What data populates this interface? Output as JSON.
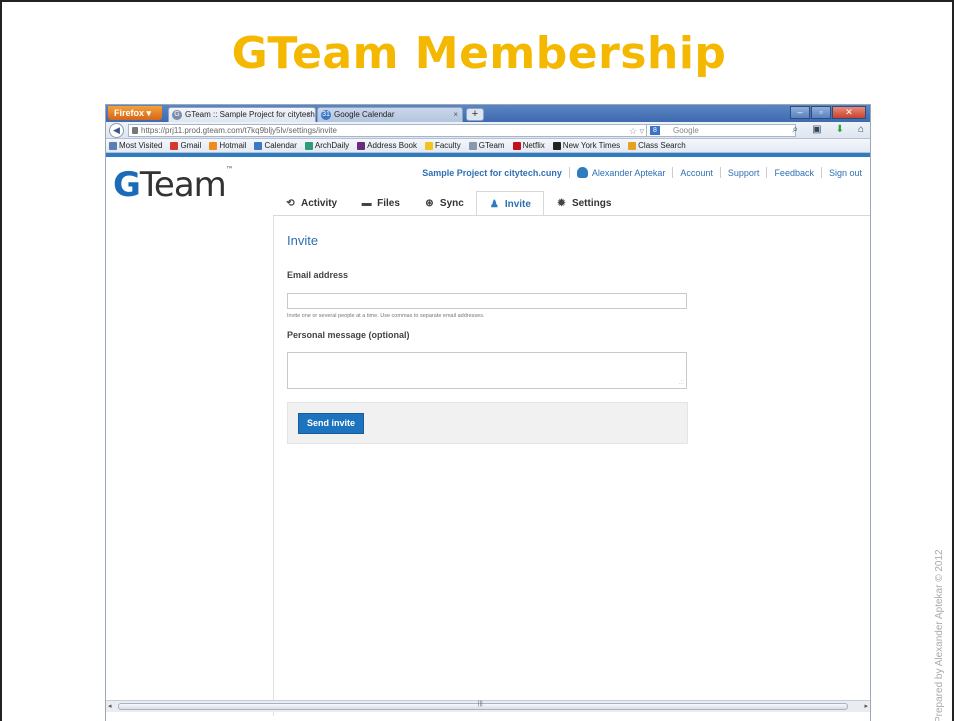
{
  "slide": {
    "title": "GTeam Membership",
    "credit": "Prepared by Alexander Aptekar © 2012"
  },
  "browser": {
    "firefox_label": "Firefox",
    "tabs": [
      {
        "label": "GTeam :: Sample Project for citytech...."
      },
      {
        "label": "Google Calendar"
      }
    ],
    "url": "https://prj11.prod.gteam.com/t7kq9bljy5lv/settings/invite",
    "url_host_bold": "gteam.com",
    "search_placeholder": "Google",
    "bookmarks": [
      {
        "label": "Most Visited",
        "color": "#5a7fb3"
      },
      {
        "label": "Gmail",
        "color": "#d23a2f"
      },
      {
        "label": "Hotmail",
        "color": "#f28b1f"
      },
      {
        "label": "Calendar",
        "color": "#3a77c9"
      },
      {
        "label": "ArchDaily",
        "color": "#2e9c7a"
      },
      {
        "label": "Address Book",
        "color": "#6a2b7e"
      },
      {
        "label": "Faculty",
        "color": "#f2c21f"
      },
      {
        "label": "GTeam",
        "color": "#8a98ad"
      },
      {
        "label": "Netflix",
        "color": "#c1121c"
      },
      {
        "label": "New York Times",
        "color": "#222222"
      },
      {
        "label": "Class Search",
        "color": "#e6a11f"
      }
    ]
  },
  "app": {
    "logo_g": "G",
    "logo_rest": "Team",
    "logo_tm": "™",
    "topnav": {
      "project": "Sample Project for citytech.cuny",
      "user": "Alexander Aptekar",
      "account": "Account",
      "support": "Support",
      "feedback": "Feedback",
      "signout": "Sign out"
    },
    "tabs": [
      {
        "label": "Activity",
        "icon": "history-icon"
      },
      {
        "label": "Files",
        "icon": "folder-icon"
      },
      {
        "label": "Sync",
        "icon": "sync-icon"
      },
      {
        "label": "Invite",
        "icon": "user-add-icon",
        "active": true
      },
      {
        "label": "Settings",
        "icon": "gear-icon"
      }
    ],
    "invite": {
      "heading": "Invite",
      "email_label": "Email address",
      "email_value": "",
      "hint": "Invite one or several people at a time. Use commas to separate email addresses.",
      "message_label": "Personal message (optional)",
      "message_value": "",
      "send_label": "Send invite"
    }
  },
  "colors": {
    "title_yellow": "#f5b800",
    "brand_blue": "#1e73be"
  }
}
